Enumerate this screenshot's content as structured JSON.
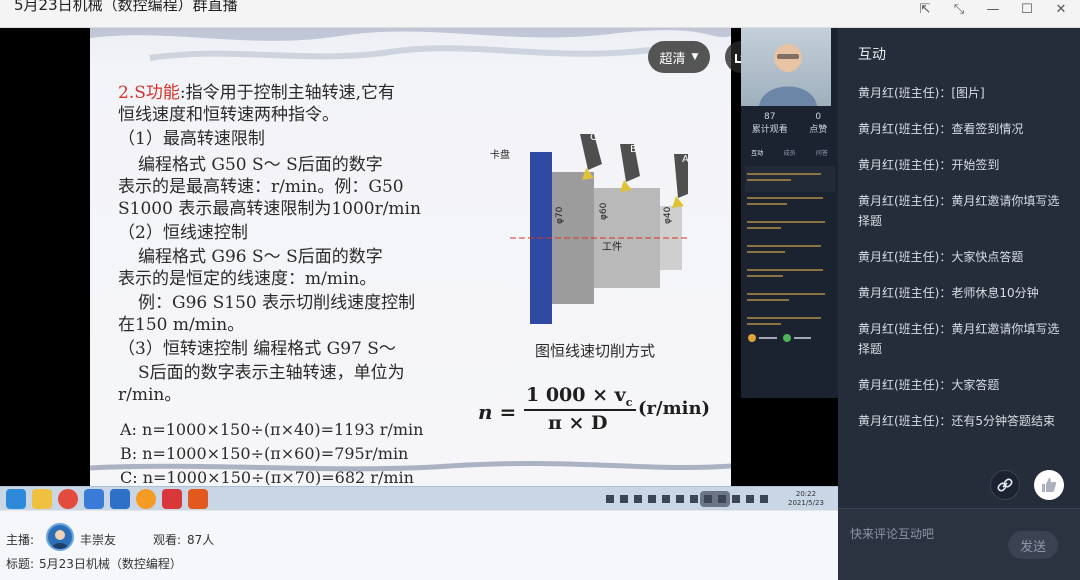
{
  "window": {
    "title": "5月23日机械（数控编程）群直播"
  },
  "slide": {
    "heading_red": "2.S功能",
    "heading_rest": ":指令用于控制主轴转速,它有",
    "line2": "恒线速度和恒转速两种指令。",
    "item1_title": "（1）最高转速限制",
    "item1_a": "编程格式 G50 S～    S后面的数字",
    "item1_b": "表示的是最高转速：r/min。例：G50",
    "item1_c": "S1000 表示最高转速限制为1000r/min",
    "item2_title": "（2）恒线速控制",
    "item2_a": "编程格式 G96 S～    S后面的数字",
    "item2_b": "表示的是恒定的线速度：m/min。",
    "item2_c": "例：G96 S150 表示切削线速度控制",
    "item2_d": "在150 m/min。",
    "item3_a": "（3）恒转速控制   编程格式 G97 S～",
    "item3_b": "S后面的数字表示主轴转速，单位为",
    "item3_c": "r/min。",
    "calc_a": "A:  n=1000×150÷(π×40)=1193 r/min",
    "calc_b": "B:  n=1000×150÷(π×60)=795r/min",
    "calc_c": "C:  n=1000×150÷(π×70)=682 r/min",
    "figure_caption": "图恒线速切削方式",
    "chuck_label": "卡盘",
    "workpiece_label": "工件",
    "tool_a": "A",
    "tool_b": "B",
    "tool_c": "C",
    "dia_70": "φ70",
    "dia_60": "φ60",
    "dia_40": "φ40",
    "formula_lhs": "n =",
    "formula_num": "1 000 × v",
    "formula_sub": "c",
    "formula_den": "π × D",
    "formula_unit": "(r/min)"
  },
  "overlay": {
    "quality_label": "超清",
    "more_label": "•••"
  },
  "mini_panel": {
    "stat1_value": "87",
    "stat1_label": "累计观看",
    "stat2_value": "0",
    "stat2_label": "点赞",
    "tab1": "互动",
    "tab2": "成员",
    "tab3": "问答"
  },
  "taskbar": {
    "time": "20:22",
    "date": "2021/5/23"
  },
  "info": {
    "host_label": "主播:",
    "host_name": "丰崇友",
    "views_label": "观看:",
    "views_value": "87人",
    "topic_label": "标题:",
    "topic_value": "5月23日机械（数控编程）"
  },
  "sidebar": {
    "title": "互动",
    "messages": [
      {
        "who": "黄月红(班主任)：",
        "text": "[图片]"
      },
      {
        "who": "黄月红(班主任)：",
        "text": "查看签到情况"
      },
      {
        "who": "黄月红(班主任)：",
        "text": "开始签到"
      },
      {
        "who": "黄月红(班主任)：",
        "text": "黄月红邀请你填写选择题"
      },
      {
        "who": "黄月红(班主任)：",
        "text": "大家快点答题"
      },
      {
        "who": "黄月红(班主任)：",
        "text": "老师休息10分钟"
      },
      {
        "who": "黄月红(班主任)：",
        "text": "黄月红邀请你填写选择题"
      },
      {
        "who": "黄月红(班主任)：",
        "text": "大家答题"
      },
      {
        "who": "黄月红(班主任)：",
        "text": "还有5分钟答题结束"
      }
    ],
    "comment_placeholder": "快来评论互动吧",
    "send_label": "发送"
  },
  "colors": {
    "sidebar_bg": "#262d3a",
    "heading_red": "#d6322a",
    "panel_dark": "#1b2331"
  }
}
